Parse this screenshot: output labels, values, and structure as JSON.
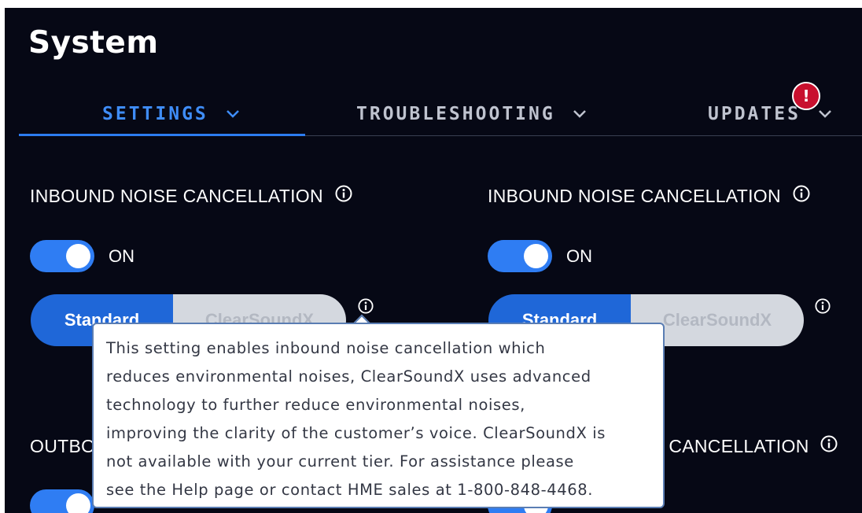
{
  "page": {
    "title": "System"
  },
  "tabs": [
    {
      "label": "SETTINGS",
      "active": true
    },
    {
      "label": "TROUBLESHOOTING",
      "active": false
    },
    {
      "label": "UPDATES",
      "active": false,
      "badge": "!"
    }
  ],
  "left_column": {
    "inbound": {
      "label": "INBOUND NOISE CANCELLATION",
      "toggle_state": "ON",
      "modes": [
        "Standard",
        "ClearSoundX"
      ],
      "selected_mode": "Standard"
    },
    "outbound": {
      "label_visible": "OUTBO",
      "toggle_state": "ON"
    }
  },
  "right_column": {
    "inbound": {
      "label": "INBOUND NOISE CANCELLATION",
      "toggle_state": "ON",
      "modes": [
        "Standard",
        "ClearSoundX"
      ],
      "selected_mode": "Standard"
    },
    "outbound": {
      "label_visible": "E CANCELLATION",
      "toggle_state": "ON"
    }
  },
  "tooltip": {
    "lines": [
      "This setting enables inbound noise cancellation which",
      "reduces environmental noises, ClearSoundX uses advanced",
      "technology to further reduce environmental noises,",
      "improving the clarity of the customer’s voice. ClearSoundX is",
      "not available with your current tier. For assistance please",
      "see the Help page or contact HME sales at 1-800-848-4468."
    ]
  },
  "colors": {
    "background": "#060815",
    "accent": "#2f7df3",
    "active_tab": "#3f8df8",
    "badge": "#c8102e"
  },
  "icons": [
    "chevron-down-icon",
    "info-icon",
    "alert-icon"
  ]
}
